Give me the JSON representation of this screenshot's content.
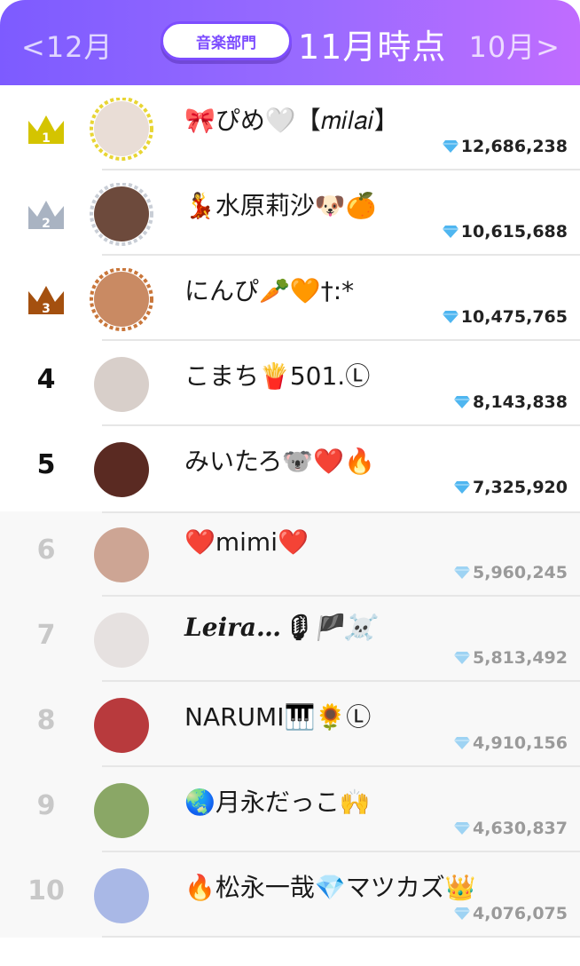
{
  "header": {
    "prev_label": "<12月",
    "category_label": "音楽部門",
    "period_label": "11月時点",
    "next_label": "10月>"
  },
  "colors": {
    "header_gradient_start": "#7d5bff",
    "header_gradient_end": "#c06cff",
    "accent": "#7d4dff",
    "crown_gold": "#d4c400",
    "crown_silver": "#a9b3c2",
    "crown_bronze": "#a4500f",
    "gem_blue": "#4fb6f0"
  },
  "rankings": [
    {
      "rank": "1",
      "name": "🎀ぴめ🤍【𝑚𝑖𝑙𝑎𝑖】",
      "score": "12,686,238",
      "icon": "gold-crown-icon",
      "avatar_color": "#e9ddd6"
    },
    {
      "rank": "2",
      "name": "💃水原莉沙🐶🍊",
      "score": "10,615,688",
      "icon": "silver-crown-icon",
      "avatar_color": "#6d4a3c"
    },
    {
      "rank": "3",
      "name": "にんぴ🥕🧡†:*",
      "score": "10,475,765",
      "icon": "bronze-crown-icon",
      "avatar_color": "#c98a63"
    },
    {
      "rank": "4",
      "name": "こまち🍟501.Ⓛ",
      "score": "8,143,838",
      "avatar_color": "#d8cfca"
    },
    {
      "rank": "5",
      "name": "みいたろ🐨❤️🔥",
      "score": "7,325,920",
      "avatar_color": "#5a2a22"
    },
    {
      "rank": "6",
      "name": "❤️mimi❤️",
      "score": "5,960,245",
      "avatar_color": "#cda594"
    },
    {
      "rank": "7",
      "name": "Leira…🎙🏴☠️",
      "score": "5,813,492",
      "avatar_color": "#e6e1e0"
    },
    {
      "rank": "8",
      "name": "NARUMI🎹🌻Ⓛ",
      "score": "4,910,156",
      "avatar_color": "#b83a3d"
    },
    {
      "rank": "9",
      "name": "🌏月永だっこ🙌",
      "score": "4,630,837",
      "avatar_color": "#8aa766"
    },
    {
      "rank": "10",
      "name": "🔥松永一哉💎マツカズ👑",
      "score": "4,076,075",
      "avatar_color": "#a9b8e6"
    }
  ]
}
